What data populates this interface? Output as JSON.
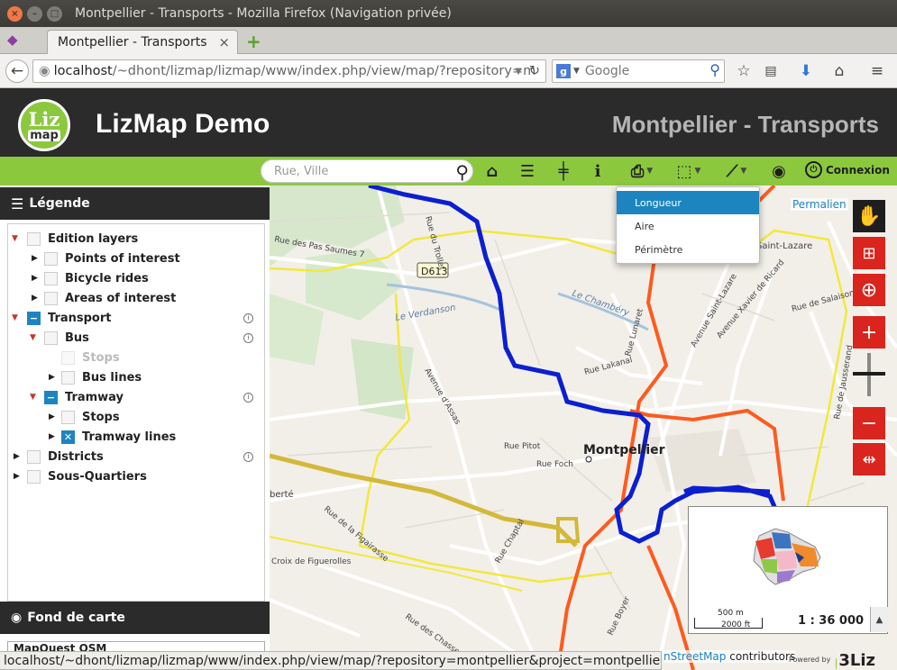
{
  "window": {
    "title": "Montpellier - Transports - Mozilla Firefox (Navigation privée)"
  },
  "browser": {
    "tab_label": "Montpellier - Transports",
    "url_host": "localhost",
    "url_path": "/~dhont/lizmap/lizmap/www/index.php/view/map/?repository=m",
    "search_engine": "Google",
    "search_placeholder": "Google",
    "status_url": "localhost/~dhont/lizmap/lizmap/www/index.php/view/map/?repository=montpellier&project=montpellier#"
  },
  "app": {
    "logo_line1": "Liz",
    "logo_line2": "map",
    "title": "LizMap Demo",
    "project_title": "Montpellier - Transports",
    "accent_color": "#8cc83e",
    "control_color": "#d9251d"
  },
  "toolbar": {
    "search_placeholder": "Rue, Ville",
    "connexion_label": "Connexion",
    "icons": [
      "home-icon",
      "list-icon",
      "edit-icon",
      "info-icon",
      "print-icon",
      "selection-icon",
      "measure-icon",
      "geolocate-icon"
    ]
  },
  "measure_menu": {
    "items": [
      "Longueur",
      "Aire",
      "Périmètre"
    ],
    "active_index": 0
  },
  "legend": {
    "title": "Légende",
    "rows": [
      {
        "label": "Edition layers"
      },
      {
        "label": "Points of interest"
      },
      {
        "label": "Bicycle rides"
      },
      {
        "label": "Areas of interest"
      },
      {
        "label": "Transport"
      },
      {
        "label": "Bus"
      },
      {
        "label": "Stops"
      },
      {
        "label": "Bus lines"
      },
      {
        "label": "Tramway"
      },
      {
        "label": "Stops"
      },
      {
        "label": "Tramway lines"
      },
      {
        "label": "Districts"
      },
      {
        "label": "Sous-Quartiers"
      }
    ]
  },
  "basemap": {
    "title": "Fond de carte",
    "selected": "MapQuest OSM"
  },
  "map": {
    "labels": {
      "city": "Montpellier",
      "road_d613": "D613",
      "verdanson": "Le Verdanson",
      "chambery": "Le Chambéry",
      "pas_saumes": "Rue des Pas Saumes 7",
      "rue_lunaret": "Rue Lunaret",
      "rue_lakanal": "Rue Lakanal",
      "rue_pitot": "Rue Pitot",
      "rue_foch": "Rue Foch",
      "av_assas": "Avenue d'Assas",
      "rue_figairasse": "Rue de la Figairasse",
      "croix_figuerolles": "Croix de Figuerolles",
      "rue_chaptal": "Rue Chaptal",
      "rue_chasseurs": "Rue des Chasseurs",
      "rue_boyer": "Rue Boyer",
      "av_st_lazare": "Avenue Saint-Lazare",
      "av_ricard": "Avenue Xavier de Ricard",
      "rue_salaison": "Rue de Salaison",
      "rue_jausserand": "Rue de Jausserand",
      "rue_trollet": "Rue du Trollet",
      "berte": "berté",
      "st_lazare": "Saint-Lazare"
    },
    "permalink": "Permalien",
    "attribution_prefix": "",
    "attribution_link": "nStreetMap",
    "attribution_suffix": "contributors",
    "powered_by": "Powered by",
    "brand_3liz": "3Liz",
    "scale_m": "500 m",
    "scale_ft": "2000 ft",
    "scale_ratio": "1 : 36 000"
  }
}
